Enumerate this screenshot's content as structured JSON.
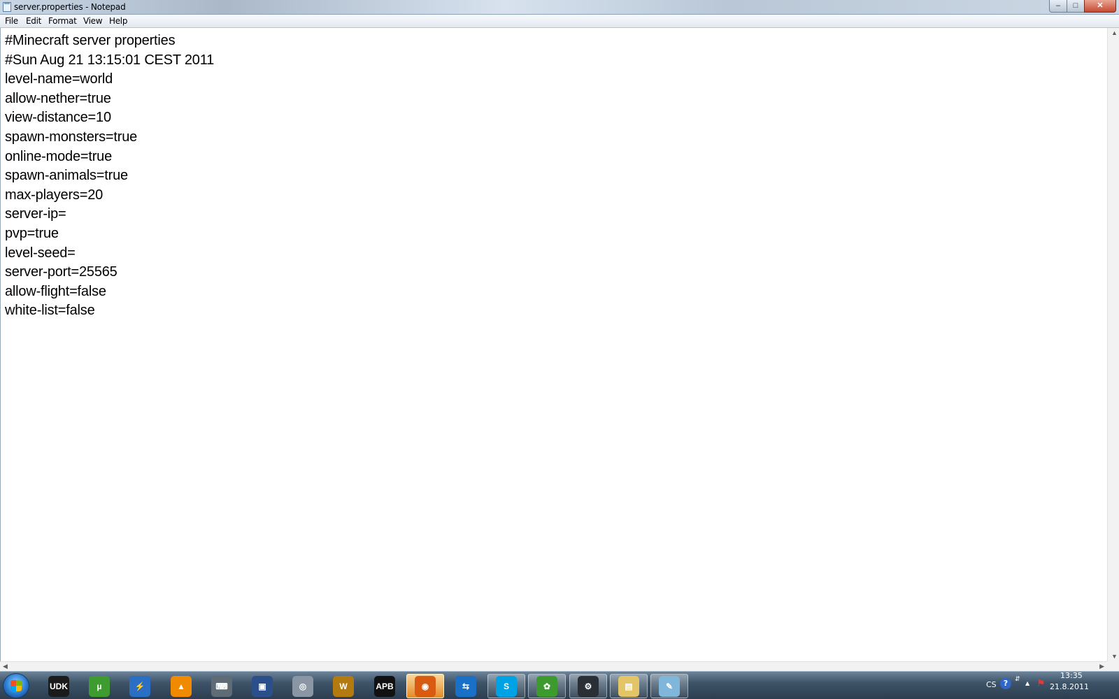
{
  "window": {
    "title": "server.properties - Notepad",
    "controls": {
      "minimize": "–",
      "maximize": "□",
      "close": "✕"
    }
  },
  "menu": [
    "File",
    "Edit",
    "Format",
    "View",
    "Help"
  ],
  "editor": {
    "lines": [
      "#Minecraft server properties",
      "#Sun Aug 21 13:15:01 CEST 2011",
      "level-name=world",
      "allow-nether=true",
      "view-distance=10",
      "spawn-monsters=true",
      "online-mode=true",
      "spawn-animals=true",
      "max-players=20",
      "server-ip=",
      "pvp=true",
      "level-seed=",
      "server-port=25565",
      "allow-flight=false",
      "white-list=false"
    ]
  },
  "taskbar": {
    "apps": [
      {
        "name": "udk-icon",
        "label": "UDK",
        "color": "#1b1b1b",
        "state": "pinned"
      },
      {
        "name": "utorrent-icon",
        "label": "µ",
        "color": "#3d9b2f",
        "state": "pinned"
      },
      {
        "name": "daemon-tools-icon",
        "label": "⚡",
        "color": "#2a6fc4",
        "state": "pinned"
      },
      {
        "name": "vlc-icon",
        "label": "▲",
        "color": "#f08a00",
        "state": "pinned"
      },
      {
        "name": "gamepad-icon",
        "label": "⌨",
        "color": "#5f6b75",
        "state": "pinned"
      },
      {
        "name": "display-settings-icon",
        "label": "▣",
        "color": "#2a4f8a",
        "state": "pinned"
      },
      {
        "name": "safari-icon",
        "label": "◎",
        "color": "#8a96a3",
        "state": "pinned"
      },
      {
        "name": "world-of-warcraft-icon",
        "label": "W",
        "color": "#b37a10",
        "state": "pinned"
      },
      {
        "name": "apb-icon",
        "label": "APB",
        "color": "#111111",
        "state": "pinned"
      },
      {
        "name": "firefox-icon",
        "label": "◉",
        "color": "#d95b12",
        "state": "active"
      },
      {
        "name": "teamviewer-icon",
        "label": "⇆",
        "color": "#1a6fc7",
        "state": "pinned"
      },
      {
        "name": "skype-icon",
        "label": "S",
        "color": "#00a2e6",
        "state": "open"
      },
      {
        "name": "icq-icon",
        "label": "✿",
        "color": "#3c9a2e",
        "state": "open"
      },
      {
        "name": "steam-icon",
        "label": "⚙",
        "color": "#2a2f36",
        "state": "open"
      },
      {
        "name": "explorer-icon",
        "label": "▤",
        "color": "#e3c466",
        "state": "open"
      },
      {
        "name": "notepad-icon",
        "label": "✎",
        "color": "#7fb6d9",
        "state": "open"
      }
    ]
  },
  "tray": {
    "language": "CS",
    "help": "?",
    "expand": "▲",
    "time": "13:35",
    "date": "21.8.2011"
  }
}
